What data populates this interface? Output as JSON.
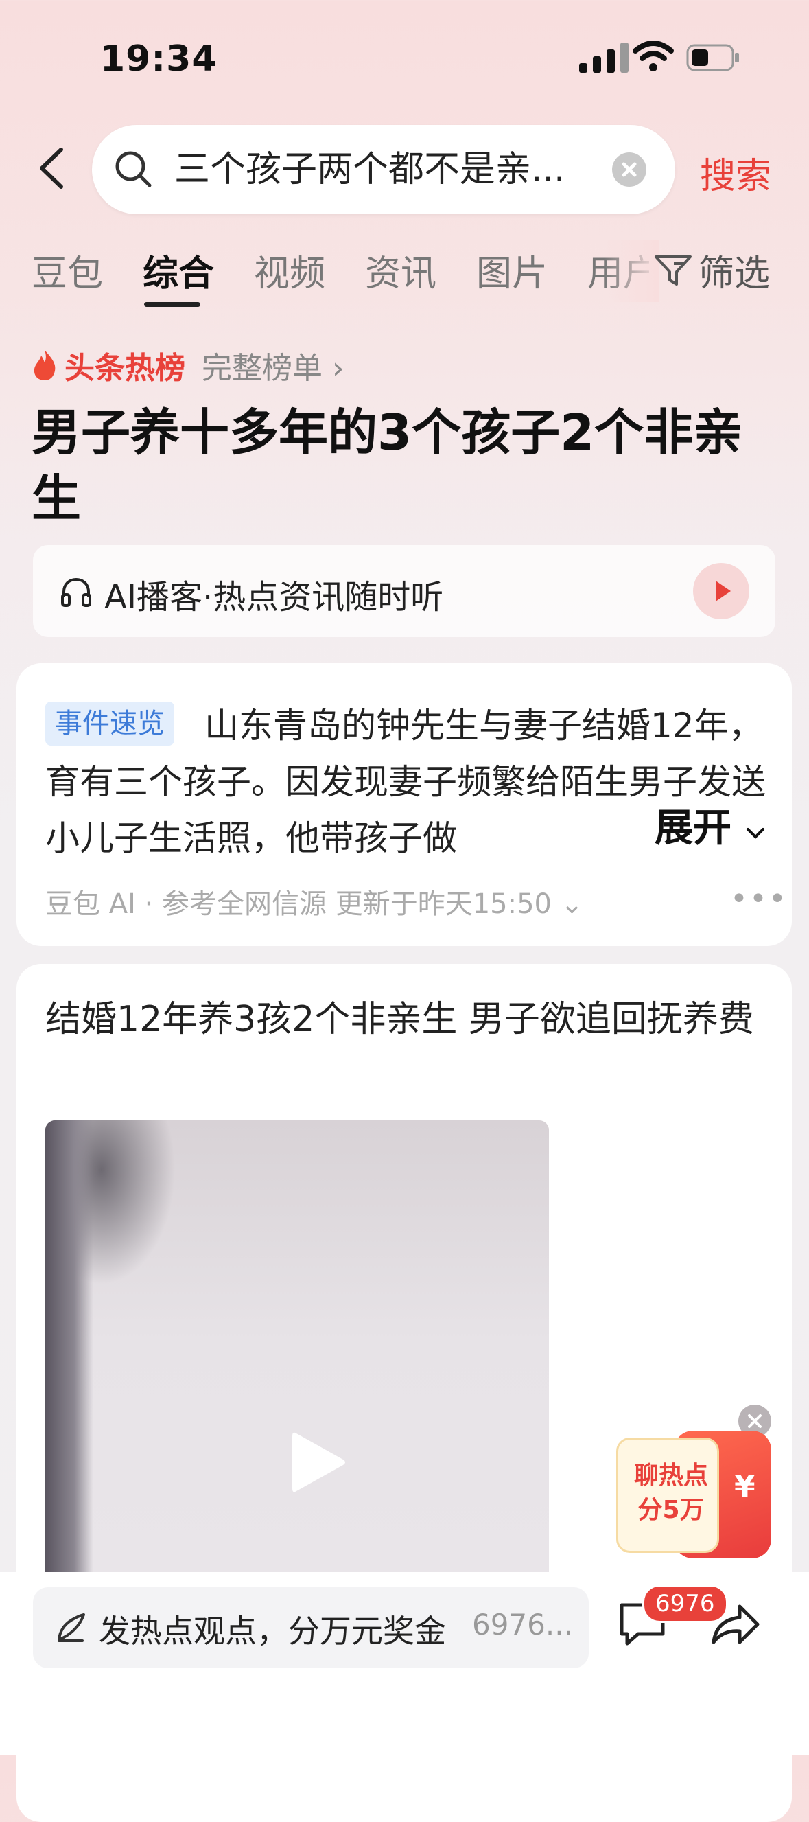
{
  "status": {
    "time": "19:34"
  },
  "search": {
    "query": "三个孩子两个都不是亲...",
    "submit_label": "搜索"
  },
  "tabs": [
    {
      "label": "豆包"
    },
    {
      "label": "综合",
      "active": true
    },
    {
      "label": "视频"
    },
    {
      "label": "资讯"
    },
    {
      "label": "图片"
    },
    {
      "label": "用户"
    }
  ],
  "filter_label": "筛选",
  "hot": {
    "label": "头条热榜",
    "link": "完整榜单 ›",
    "headline": "男子养十多年的3个孩子2个非亲生"
  },
  "podcast": {
    "text": "AI播客·热点资讯随时听"
  },
  "summary": {
    "badge": "事件速览",
    "text": "山东青岛的钟先生与妻子结婚12年，育有三个孩子。因发现妻子频繁给陌生男子发送小儿子生活照，他带孩子做",
    "expand_label": "展开",
    "source": "豆包 AI · 参考全网信源 更新于昨天15:50 ⌄"
  },
  "news": {
    "title": "结婚12年养3孩2个非亲生 男子欲追回抚养费"
  },
  "promo": {
    "line1": "聊热点",
    "line2": "分5万",
    "yen": "¥"
  },
  "bottom": {
    "comment_placeholder": "发热点观点，分万元奖金",
    "comment_count_inline": "6976...",
    "badge_count": "6976"
  }
}
